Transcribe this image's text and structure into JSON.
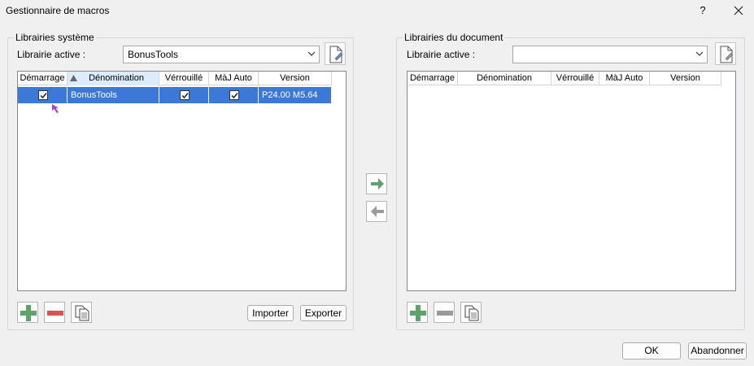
{
  "window": {
    "title": "Gestionnaire de macros",
    "help_label": "?"
  },
  "colors": {
    "selection": "#3b78d8",
    "add_green": "#5fa36b",
    "remove_red": "#d9534f",
    "remove_gray": "#9a9a9a",
    "cursor": "#b03ad8"
  },
  "left": {
    "group_label": "Librairies système",
    "active_label": "Librairie active :",
    "active_value": "BonusTools",
    "columns": [
      "Démarrage",
      "Dénomination",
      "Vérrouillé",
      "MàJ Auto",
      "Version"
    ],
    "rows": [
      {
        "startup": true,
        "name": "BonusTools",
        "locked": true,
        "auto_update": true,
        "version": "P24.00 M5.64"
      }
    ],
    "import_label": "Importer",
    "export_label": "Exporter"
  },
  "right": {
    "group_label": "Librairies du document",
    "active_label": "Librairie active :",
    "active_value": "",
    "columns": [
      "Démarrage",
      "Dénomination",
      "Vérrouillé",
      "MàJ Auto",
      "Version"
    ]
  },
  "footer": {
    "ok_label": "OK",
    "cancel_label": "Abandonner"
  },
  "icons": {
    "close": "close-icon",
    "combo_arrow": "chevron-down-icon",
    "new_doc": "new-document-icon",
    "sort": "sort-up-icon",
    "check": "check-icon",
    "move_right": "arrow-right-icon",
    "move_left": "arrow-left-icon",
    "add": "plus-icon",
    "remove": "minus-icon",
    "copy": "copy-icon",
    "cursor": "mouse-cursor-icon"
  }
}
